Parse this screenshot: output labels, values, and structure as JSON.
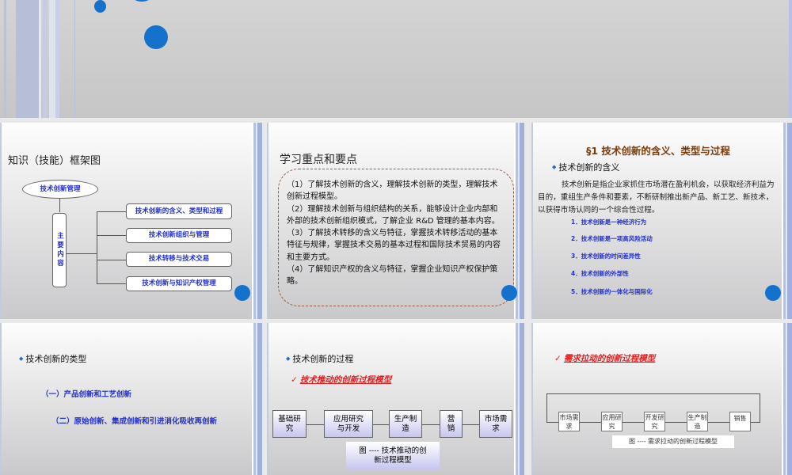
{
  "slide1": {},
  "slide2": {
    "title": "知识（技能）框架图",
    "root": "技术创新管理",
    "main": "主要内容",
    "items": [
      "技术创新的含义、类型和过程",
      "技术创新组织与管理",
      "技术转移与技术交易",
      "技术创新与知识产权管理"
    ]
  },
  "slide3": {
    "title": "学习重点和要点",
    "points": [
      "（1）了解技术创新的含义，理解技术创新的类型，理解技术创新过程模型。",
      "（2）理解技术创新与组织结构的关系，能够设计企业内部和外部的技术创新组织模式，了解企业 R&D 管理的基本内容。",
      "（3）了解技术转移的含义与特征，掌握技术转移活动的基本特征与规律，掌握技术交易的基本过程和国际技术贸易的内容和主要方式。",
      "（4）了解知识产权的含义与特征，掌握企业知识产权保护策略。"
    ]
  },
  "slide4": {
    "title": "§1  技术创新的含义、类型与过程",
    "bullet": "技术创新的含义",
    "paragraph": "技术创新是指企业家抓住市场潜在盈利机会，以获取经济利益为目的，重组生产条件和要素，不断研制推出新产品、新工艺、新技术，以获得市场认同的一个综合性过程。",
    "items": [
      "1．技术创新是一种经济行为",
      "2．技术创新是一项高风险活动",
      "3．技术创新的时间差异性",
      "4．技术创新的外部性",
      "5．技术创新的一体化与国际化"
    ]
  },
  "slide5": {
    "bullet": "技术创新的类型",
    "items": [
      "（一）产品创新和工艺创新",
      "（二）原始创新、集成创新和引进消化吸收再创新"
    ]
  },
  "slide6": {
    "bullet": "技术创新的过程",
    "subtitle": "技术推动的创新过程模型",
    "steps": [
      "基础研究",
      "应用研究与开发",
      "生产制造",
      "营销",
      "市场需求"
    ],
    "caption": "图 ---- 技术推动的创新过程模型"
  },
  "slide7": {
    "subtitle": "需求拉动的创新过程模型",
    "steps": [
      "市场需求",
      "应用研究",
      "开发研究",
      "生产制造",
      "销售"
    ],
    "caption": "图 ---- 需求拉动的创新过程模型"
  },
  "colors": {
    "accent": "#1472cc",
    "title_brown": "#7a3b0b",
    "item_blue": "#2230c8",
    "red": "#e02020"
  }
}
